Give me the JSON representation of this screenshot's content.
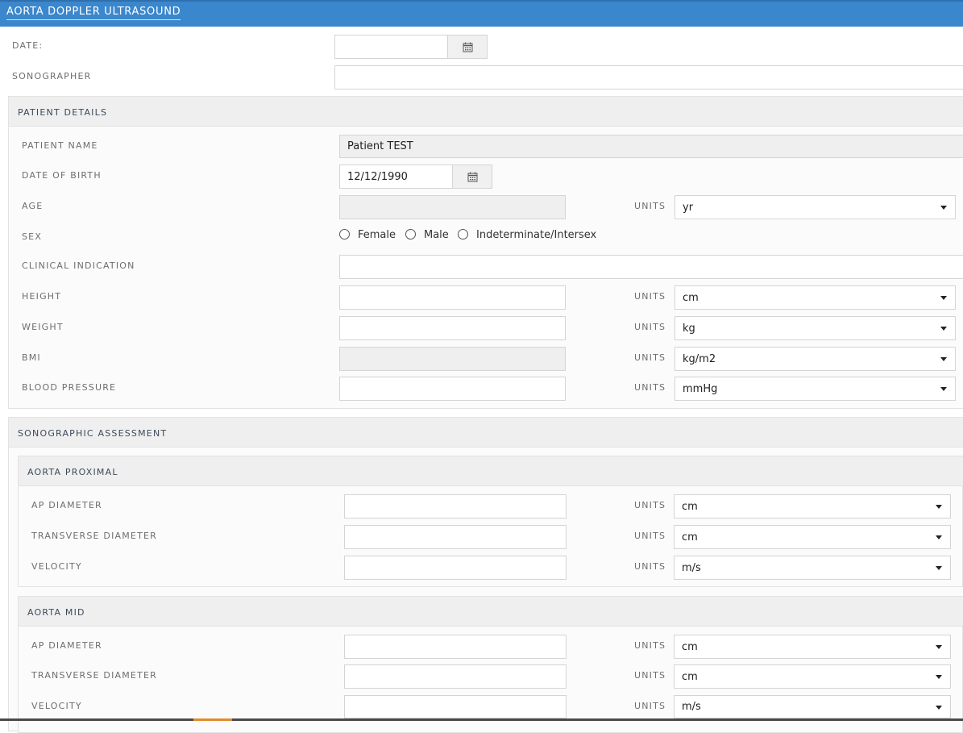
{
  "window": {
    "title": "AORTA DOPPLER ULTRASOUND"
  },
  "form": {
    "date": {
      "label": "DATE:",
      "value": "",
      "icon": "calendar-icon"
    },
    "sonographer": {
      "label": "SONOGRAPHER",
      "value": ""
    }
  },
  "patient": {
    "title": "PATIENT DETAILS",
    "name": {
      "label": "PATIENT NAME",
      "value": "Patient TEST"
    },
    "dob": {
      "label": "DATE OF BIRTH",
      "value": "12/12/1990",
      "icon": "calendar-icon"
    },
    "age": {
      "label": "AGE",
      "value": "",
      "units_label": "UNITS",
      "units": "yr"
    },
    "sex": {
      "label": "SEX",
      "options": [
        "Female",
        "Male",
        "Indeterminate/Intersex"
      ],
      "selected": null
    },
    "clinical": {
      "label": "CLINICAL INDICATION",
      "value": ""
    },
    "height": {
      "label": "HEIGHT",
      "value": "",
      "units_label": "UNITS",
      "units": "cm"
    },
    "weight": {
      "label": "WEIGHT",
      "value": "",
      "units_label": "UNITS",
      "units": "kg"
    },
    "bmi": {
      "label": "BMI",
      "value": "",
      "units_label": "UNITS",
      "units": "kg/m2"
    },
    "bp": {
      "label": "BLOOD PRESSURE",
      "value": "",
      "units_label": "UNITS",
      "units": "mmHg"
    }
  },
  "assessment": {
    "title": "SONOGRAPHIC ASSESSMENT",
    "proximal": {
      "title": "AORTA PROXIMAL",
      "ap": {
        "label": "AP DIAMETER",
        "value": "",
        "units_label": "UNITS",
        "units": "cm"
      },
      "trans": {
        "label": "TRANSVERSE DIAMETER",
        "value": "",
        "units_label": "UNITS",
        "units": "cm"
      },
      "vel": {
        "label": "VELOCITY",
        "value": "",
        "units_label": "UNITS",
        "units": "m/s"
      }
    },
    "mid": {
      "title": "AORTA MID",
      "ap": {
        "label": "AP DIAMETER",
        "value": "",
        "units_label": "UNITS",
        "units": "cm"
      },
      "trans": {
        "label": "TRANSVERSE DIAMETER",
        "value": "",
        "units_label": "UNITS",
        "units": "cm"
      },
      "vel": {
        "label": "VELOCITY",
        "value": "",
        "units_label": "UNITS",
        "units": "m/s"
      }
    }
  },
  "colors": {
    "header": "#3a87cd",
    "panel_head": "#efefef",
    "readonly": "#efefef"
  }
}
